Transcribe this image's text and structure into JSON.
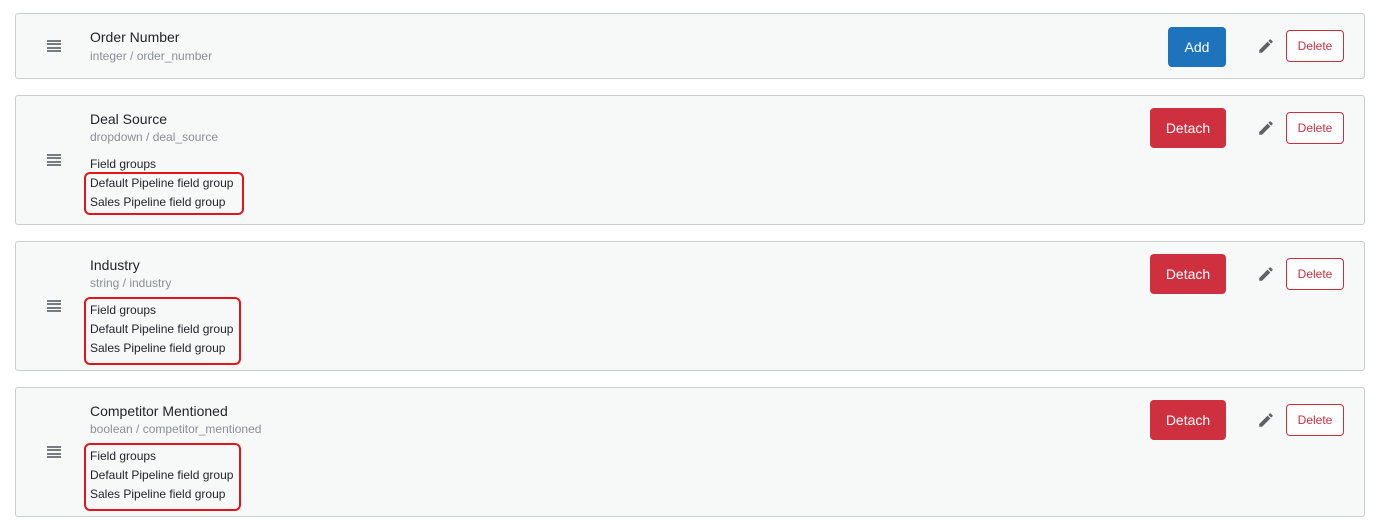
{
  "fields": [
    {
      "name": "Order Number",
      "meta": "integer / order_number",
      "action_label": "Add",
      "action_type": "add",
      "delete_label": "Delete",
      "groups_label": "",
      "groups": []
    },
    {
      "name": "Deal Source",
      "meta": "dropdown / deal_source",
      "action_label": "Detach",
      "action_type": "detach",
      "delete_label": "Delete",
      "groups_label": "Field groups",
      "groups": [
        "Default Pipeline field group",
        "Sales Pipeline field group"
      ]
    },
    {
      "name": "Industry",
      "meta": "string / industry",
      "action_label": "Detach",
      "action_type": "detach",
      "delete_label": "Delete",
      "groups_label": "Field groups",
      "groups": [
        "Default Pipeline field group",
        "Sales Pipeline field group"
      ]
    },
    {
      "name": "Competitor Mentioned",
      "meta": "boolean / competitor_mentioned",
      "action_label": "Detach",
      "action_type": "detach",
      "delete_label": "Delete",
      "groups_label": "Field groups",
      "groups": [
        "Default Pipeline field group",
        "Sales Pipeline field group"
      ]
    }
  ],
  "icons": {
    "drag_handle": "drag-handle-icon",
    "edit": "pencil-icon"
  },
  "colors": {
    "add": "#1d74bd",
    "detach": "#cf3040",
    "delete": "#c92f3e",
    "highlight": "#e0161c",
    "card_bg": "#f7f8f8"
  }
}
